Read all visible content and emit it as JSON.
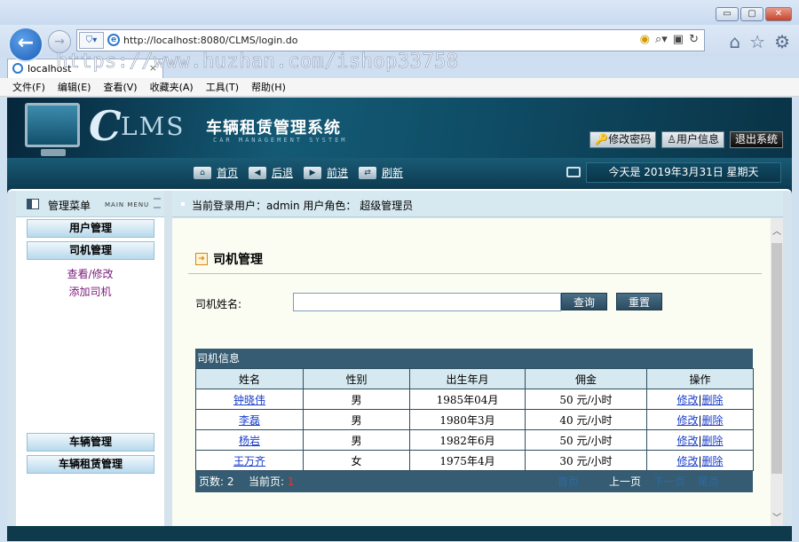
{
  "browser": {
    "url": "http://localhost:8080/CLMS/login.do",
    "tab_label": "localhost",
    "window_buttons": [
      "▭",
      "▢",
      "✕"
    ],
    "watermark": "https://www.huzhan.com/ishop33758",
    "menu": [
      "文件(F)",
      "编辑(E)",
      "查看(V)",
      "收藏夹(A)",
      "工具(T)",
      "帮助(H)"
    ]
  },
  "header": {
    "logo_c": "C",
    "logo_rest": "LMS",
    "title": "车辆租赁管理系统",
    "subtitle": "CAR   MANAGEMENT   SYSTEM",
    "buttons": {
      "change_password": "修改密码",
      "user_info": "用户信息",
      "logout": "退出系统"
    }
  },
  "nav": {
    "home": "首页",
    "back": "后退",
    "forward": "前进",
    "refresh": "刷新",
    "date": "今天是  2019年3月31日  星期天"
  },
  "sidebar": {
    "title": "管理菜单",
    "title_en": "MAIN MENU",
    "items": [
      {
        "label": "用户管理"
      },
      {
        "label": "司机管理",
        "children": [
          "查看/修改",
          "添加司机"
        ]
      },
      {
        "label": "车辆管理"
      },
      {
        "label": "车辆租赁管理"
      }
    ]
  },
  "content": {
    "login_info": "当前登录用户：admin  用户角色：  超级管理员",
    "section_title": "司机管理",
    "search_label": "司机姓名:",
    "search_value": "",
    "query_button": "查询",
    "reset_button": "重置",
    "table_caption": "司机信息",
    "columns": [
      "姓名",
      "性别",
      "出生年月",
      "佣金",
      "操作"
    ],
    "rows": [
      {
        "name": "钟晓伟",
        "gender": "男",
        "birth": "1985年04月",
        "commission": "50  元/小时"
      },
      {
        "name": "李磊",
        "gender": "男",
        "birth": "1980年3月",
        "commission": "40  元/小时"
      },
      {
        "name": "杨岩",
        "gender": "男",
        "birth": "1982年6月",
        "commission": "50  元/小时"
      },
      {
        "name": "王万齐",
        "gender": "女",
        "birth": "1975年4月",
        "commission": "30  元/小时"
      }
    ],
    "op_edit": "修改",
    "op_sep": "|",
    "op_delete": "删除",
    "footer": {
      "page_count": "页数: 2",
      "current_page_label": "当前页:",
      "current_page_value": "1",
      "first": "首页",
      "prev": "上一页",
      "next": "下一页",
      "last": "尾页"
    }
  }
}
